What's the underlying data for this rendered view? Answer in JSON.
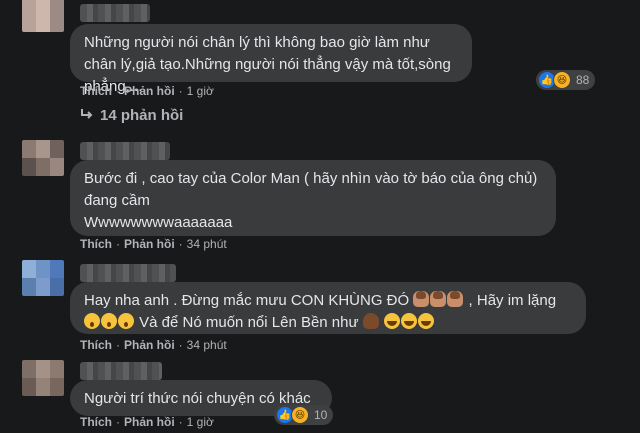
{
  "comments": [
    {
      "text": "Những người nói chân lý thì không bao giờ làm như chân lý,giả tạo.Những người nói thẳng vậy mà tốt,sòng phẳng,....",
      "like_label": "Thích",
      "reply_label": "Phản hồi",
      "time": "1 giờ",
      "reaction_count": "88",
      "reactions": [
        "like-icon",
        "haha-icon"
      ],
      "replies_label": "14 phản hồi"
    },
    {
      "text": "Bước đi , cao tay của Color Man ( hãy nhìn vào tờ báo của ông chủ) đang cầm\nWwwwwwwwaaaaaaa",
      "like_label": "Thích",
      "reply_label": "Phản hồi",
      "time": "34 phút"
    },
    {
      "text_part1": "Hay nha anh . Đừng mắc mưu CON KHÙNG ĐÓ",
      "text_part2": ", Hãy im lặng",
      "text_part3": "Và để Nó muốn nổi Lên Bền như",
      "emojis_1": [
        "person-facepalm-emoji",
        "person-facepalm-emoji",
        "person-facepalm-emoji"
      ],
      "emojis_2": [
        "shocked-face-emoji",
        "shocked-face-emoji",
        "shocked-face-emoji"
      ],
      "emojis_3": [
        "poop-emoji",
        "laughing-face-emoji",
        "laughing-face-emoji",
        "laughing-face-emoji"
      ],
      "like_label": "Thích",
      "reply_label": "Phản hồi",
      "time": "34 phút"
    },
    {
      "text": "Người trí thức nói chuyện có khác",
      "like_label": "Thích",
      "reply_label": "Phản hồi",
      "time": "1 giờ",
      "reaction_count": "10",
      "reactions": [
        "like-icon",
        "haha-icon"
      ]
    }
  ],
  "colors": {
    "background": "#18191a",
    "bubble": "#3a3b3c",
    "text": "#e4e6eb",
    "secondary_text": "#b0b3b8",
    "like_blue": "#1877f2",
    "haha_yellow": "#f7b125"
  }
}
